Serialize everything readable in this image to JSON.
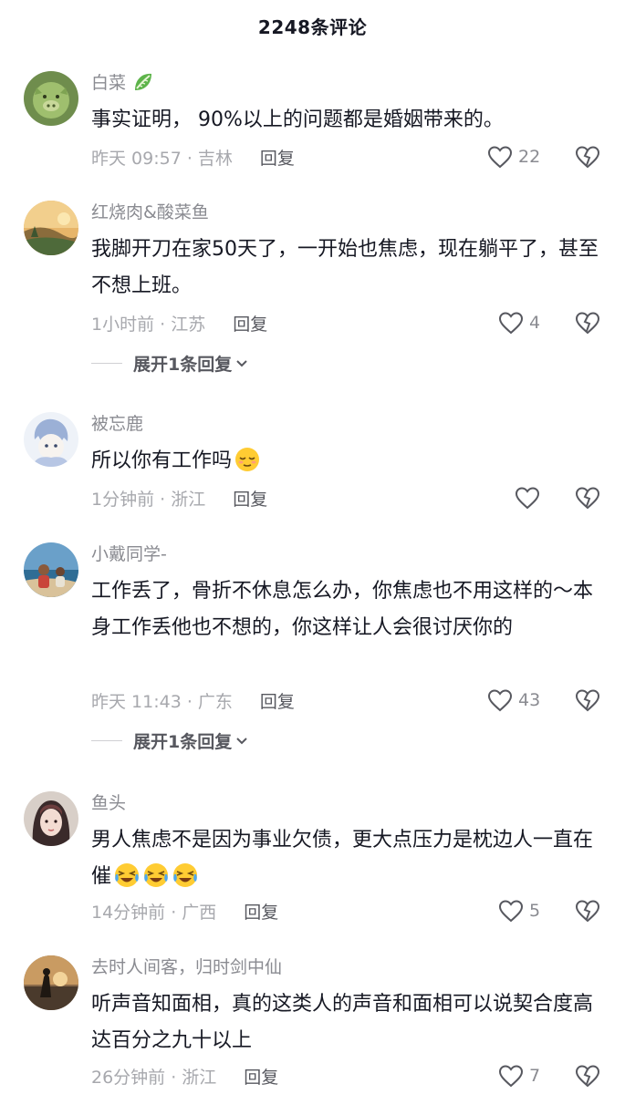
{
  "header": {
    "title": "2248条评论"
  },
  "comments": [
    {
      "username": "白菜",
      "badge_icon": "cabbage-emoji-icon",
      "text": "事实证明， 90%以上的问题都是婚姻带来的。",
      "time_location": "昨天 09:57 · 吉林",
      "reply_label": "回复",
      "likes": "22",
      "avatar_icon": "pig-avatar"
    },
    {
      "username": "红烧肉&酸菜鱼",
      "text": "我脚开刀在家50天了，一开始也焦虑，现在躺平了，甚至不想上班。",
      "time_location": "1小时前 · 江苏",
      "reply_label": "回复",
      "likes": "4",
      "expand_label": "展开1条回复",
      "avatar_icon": "sunset-landscape-avatar"
    },
    {
      "username": "被忘鹿",
      "text": "所以你有工作吗",
      "text_emoji": "relieved-face-emoji-icon",
      "time_location": "1分钟前 · 浙江",
      "reply_label": "回复",
      "likes": "",
      "avatar_icon": "anime-character-avatar"
    },
    {
      "username": "小戴同学-",
      "text": "工作丢了，骨折不休息怎么办，你焦虑也不用这样的～本身工作丢他也不想的，你这样让人会很讨厌你的",
      "time_location": "昨天 11:43 · 广东",
      "reply_label": "回复",
      "likes": "43",
      "expand_label": "展开1条回复",
      "avatar_icon": "beach-people-avatar"
    },
    {
      "username": "鱼头",
      "text": "男人焦虑不是因为事业欠债，更大点压力是枕边人一直在催",
      "text_emoji": "laughing-crying-emoji-icon",
      "time_location": "14分钟前 · 广西",
      "reply_label": "回复",
      "likes": "5",
      "avatar_icon": "woman-portrait-avatar"
    },
    {
      "username": "去时人间客，归时剑中仙",
      "text": "听声音知面相，真的这类人的声音和面相可以说契合度高达百分之九十以上",
      "time_location": "26分钟前 · 浙江",
      "reply_label": "回复",
      "likes": "7",
      "avatar_icon": "silhouette-sunset-avatar"
    }
  ],
  "colors": {
    "text_primary": "#161823",
    "text_secondary": "#8a8b91",
    "meta": "#a7a8ad",
    "reply": "#57585f",
    "divider": "#d0d0d4"
  }
}
